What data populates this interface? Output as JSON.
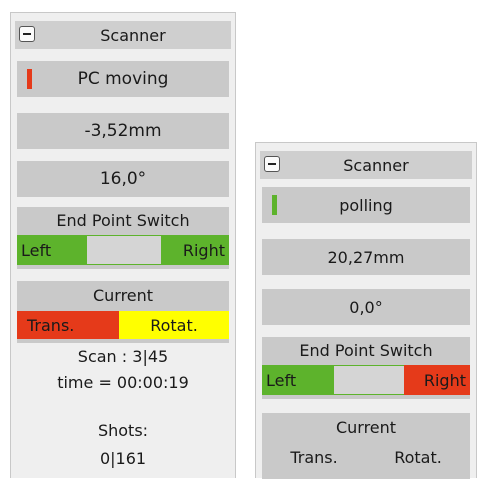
{
  "colors": {
    "active_green": "#5db32c",
    "alert_red": "#e53a1a",
    "highlight_yellow": "#ffff00"
  },
  "panels": [
    {
      "title": "Scanner",
      "status": {
        "text": "PC moving",
        "indicator_color": "#e53a1a"
      },
      "position": "-3,52mm",
      "angle": "16,0°",
      "end_point_switch": {
        "label": "End Point Switch",
        "left": "Left",
        "right": "Right",
        "left_active": true,
        "right_active": true
      },
      "current": {
        "label": "Current",
        "trans": "Trans.",
        "rotat": "Rotat."
      },
      "scan": "Scan : 3|45",
      "time": "time = 00:00:19",
      "shots_label": "Shots:",
      "shots_value": "0|161"
    },
    {
      "title": "Scanner",
      "status": {
        "text": "polling",
        "indicator_color": "#5db32c"
      },
      "position": "20,27mm",
      "angle": "0,0°",
      "end_point_switch": {
        "label": "End Point Switch",
        "left": "Left",
        "right": "Right",
        "left_active": true,
        "right_active": false
      },
      "current": {
        "label": "Current",
        "trans": "Trans.",
        "rotat": "Rotat."
      }
    }
  ]
}
